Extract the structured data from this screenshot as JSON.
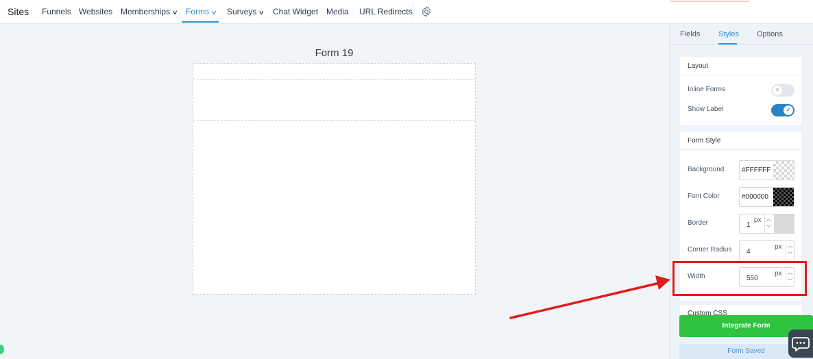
{
  "app": {
    "brand": "Sites"
  },
  "nav": {
    "items": [
      {
        "label": "Funnels"
      },
      {
        "label": "Websites"
      },
      {
        "label": "Memberships",
        "dropdown": true
      },
      {
        "label": "Forms",
        "dropdown": true,
        "active": true
      },
      {
        "label": "Surveys",
        "dropdown": true
      },
      {
        "label": "Chat Widget"
      },
      {
        "label": "Media"
      },
      {
        "label": "URL Redirects"
      }
    ],
    "settings_icon": "gear-icon"
  },
  "canvas": {
    "form_title": "Form 19"
  },
  "panel": {
    "tabs": [
      {
        "label": "Fields"
      },
      {
        "label": "Styles",
        "active": true
      },
      {
        "label": "Options"
      }
    ],
    "layout": {
      "title": "Layout",
      "inline_forms": {
        "label": "Inline Forms",
        "on": false
      },
      "show_label": {
        "label": "Show Label",
        "on": true
      }
    },
    "form_style": {
      "title": "Form Style",
      "background": {
        "label": "Background",
        "value": "#FFFFFF"
      },
      "font_color": {
        "label": "Font Color",
        "value": "#000000"
      },
      "border": {
        "label": "Border",
        "value": "1",
        "unit": "px"
      },
      "corner_radius": {
        "label": "Corner Radius",
        "value": "4",
        "unit": "px"
      },
      "width": {
        "label": "Width",
        "value": "550",
        "unit": "px"
      }
    },
    "custom_css": {
      "title": "Custom CSS"
    },
    "integrate_button": "Integrate Form",
    "status": "Form Saved"
  },
  "colors": {
    "accent": "#2d8ecb",
    "toggle_on": "#2b82c4",
    "integrate": "#2fc33f",
    "annotation": "#e11c1c"
  }
}
